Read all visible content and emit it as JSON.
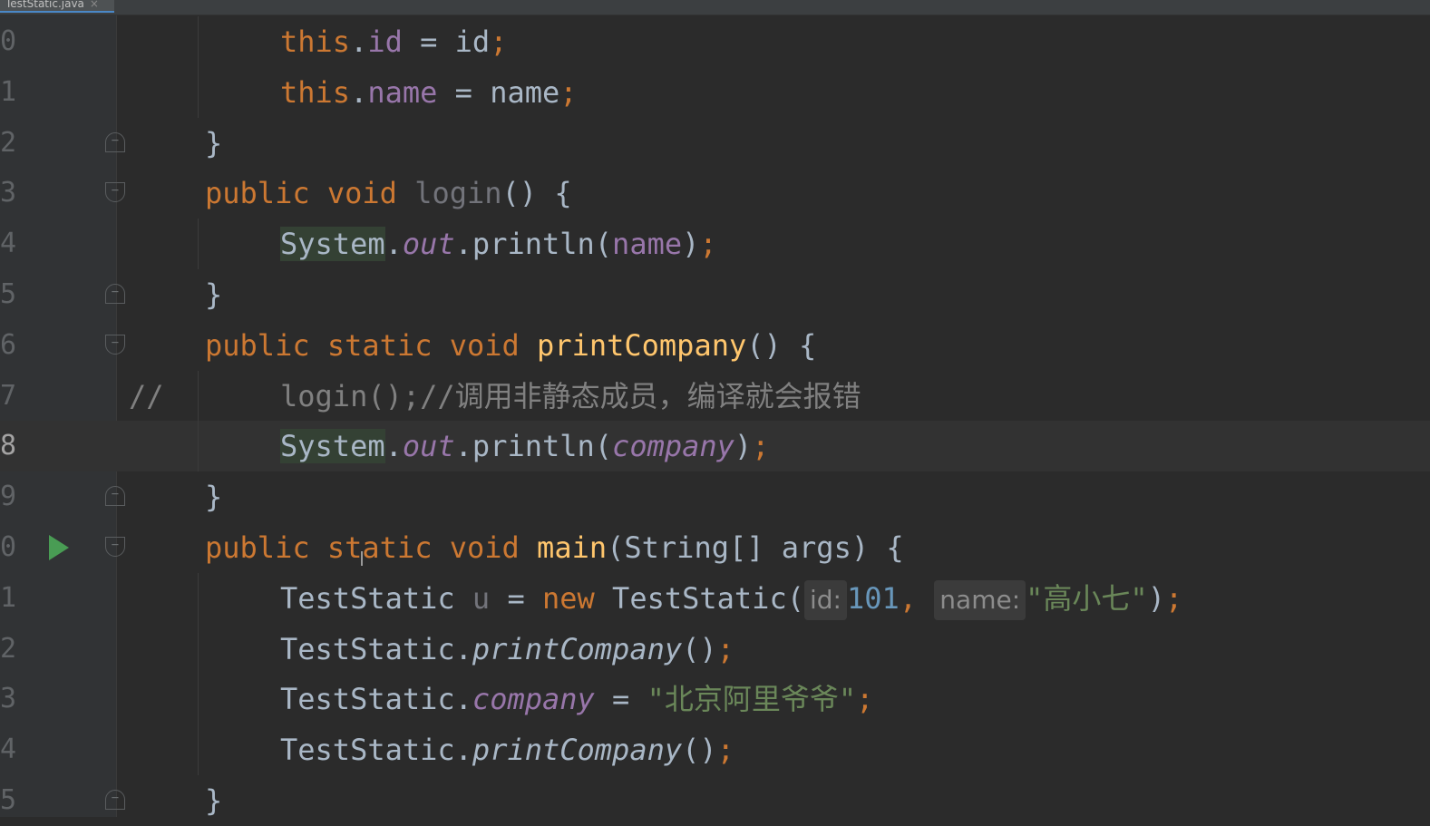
{
  "tab": {
    "filename": "TestStatic.java",
    "close": "×"
  },
  "lines": [
    {
      "num": "0",
      "comment_prefix": "",
      "tokens": [
        {
          "t": "this",
          "c": "kw"
        },
        {
          "t": ".",
          "c": ""
        },
        {
          "t": "id",
          "c": "fld"
        },
        {
          "t": " = id",
          "c": ""
        },
        {
          "t": ";",
          "c": "kw"
        }
      ]
    },
    {
      "num": "1",
      "comment_prefix": "",
      "tokens": [
        {
          "t": "this",
          "c": "kw"
        },
        {
          "t": ".",
          "c": ""
        },
        {
          "t": "name",
          "c": "fld"
        },
        {
          "t": " = name",
          "c": ""
        },
        {
          "t": ";",
          "c": "kw"
        }
      ]
    },
    {
      "num": "2",
      "comment_prefix": "",
      "tokens": [
        {
          "t": "}",
          "c": ""
        }
      ]
    },
    {
      "num": "3",
      "comment_prefix": "",
      "tokens": [
        {
          "t": "public void ",
          "c": "kw"
        },
        {
          "t": "login",
          "c": "unused"
        },
        {
          "t": "() {",
          "c": ""
        }
      ]
    },
    {
      "num": "4",
      "comment_prefix": "",
      "tokens": [
        {
          "t": "System",
          "c": "sys"
        },
        {
          "t": ".",
          "c": ""
        },
        {
          "t": "out",
          "c": "sfld"
        },
        {
          "t": ".println(",
          "c": ""
        },
        {
          "t": "name",
          "c": "fld"
        },
        {
          "t": ")",
          "c": ""
        },
        {
          "t": ";",
          "c": "kw"
        }
      ]
    },
    {
      "num": "5",
      "comment_prefix": "",
      "tokens": [
        {
          "t": "}",
          "c": ""
        }
      ]
    },
    {
      "num": "6",
      "comment_prefix": "",
      "tokens": [
        {
          "t": "public static void ",
          "c": "kw"
        },
        {
          "t": "printCompany",
          "c": "fn"
        },
        {
          "t": "() {",
          "c": ""
        }
      ]
    },
    {
      "num": "7",
      "comment_prefix": "//",
      "tokens": [
        {
          "t": "login();//调用非静态成员，编译就会报错",
          "c": "cmt"
        }
      ]
    },
    {
      "num": "8",
      "comment_prefix": "",
      "tokens": [
        {
          "t": "System",
          "c": "sys"
        },
        {
          "t": ".",
          "c": ""
        },
        {
          "t": "out",
          "c": "sfld"
        },
        {
          "t": ".println(",
          "c": ""
        },
        {
          "t": "company",
          "c": "sfld"
        },
        {
          "t": ")",
          "c": ""
        },
        {
          "t": ";",
          "c": "kw"
        }
      ]
    },
    {
      "num": "9",
      "comment_prefix": "",
      "tokens": [
        {
          "t": "}",
          "c": ""
        }
      ]
    },
    {
      "num": "0",
      "comment_prefix": "",
      "tokens": [
        {
          "t": "public static void ",
          "c": "kw"
        },
        {
          "t": "main",
          "c": "fn"
        },
        {
          "t": "(String[] args) {",
          "c": ""
        }
      ]
    },
    {
      "num": "1",
      "comment_prefix": "",
      "tokens": [
        {
          "t": "TestStatic ",
          "c": ""
        },
        {
          "t": "u",
          "c": "unused"
        },
        {
          "t": " = ",
          "c": ""
        },
        {
          "t": "new ",
          "c": "kw"
        },
        {
          "t": "TestStatic(",
          "c": ""
        },
        {
          "t": "id:",
          "c": "hint"
        },
        {
          "t": "101",
          "c": "num"
        },
        {
          "t": ", ",
          "c": "kw"
        },
        {
          "t": "name:",
          "c": "hint"
        },
        {
          "t": "\"高小七\"",
          "c": "str"
        },
        {
          "t": ")",
          "c": ""
        },
        {
          "t": ";",
          "c": "kw"
        }
      ]
    },
    {
      "num": "2",
      "comment_prefix": "",
      "tokens": [
        {
          "t": "TestStatic.",
          "c": ""
        },
        {
          "t": "printCompany",
          "c": "sfn"
        },
        {
          "t": "()",
          "c": ""
        },
        {
          "t": ";",
          "c": "kw"
        }
      ]
    },
    {
      "num": "3",
      "comment_prefix": "",
      "tokens": [
        {
          "t": "TestStatic.",
          "c": ""
        },
        {
          "t": "company",
          "c": "sfld"
        },
        {
          "t": " = ",
          "c": ""
        },
        {
          "t": "\"北京阿里爷爷\"",
          "c": "str"
        },
        {
          "t": ";",
          "c": "kw"
        }
      ]
    },
    {
      "num": "4",
      "comment_prefix": "",
      "tokens": [
        {
          "t": "TestStatic.",
          "c": ""
        },
        {
          "t": "printCompany",
          "c": "sfn"
        },
        {
          "t": "()",
          "c": ""
        },
        {
          "t": ";",
          "c": "kw"
        }
      ]
    },
    {
      "num": "5",
      "comment_prefix": "",
      "tokens": [
        {
          "t": "}",
          "c": ""
        }
      ]
    }
  ],
  "colors": {
    "background": "#2b2b2b",
    "gutter": "#313335",
    "keyword": "#cc7832",
    "field": "#9876aa",
    "method": "#ffc66d",
    "string": "#6a8759",
    "number": "#6897bb",
    "comment": "#808080",
    "run_icon": "#499c54"
  },
  "current_line_index": 8,
  "run_icon_line_index": 10
}
